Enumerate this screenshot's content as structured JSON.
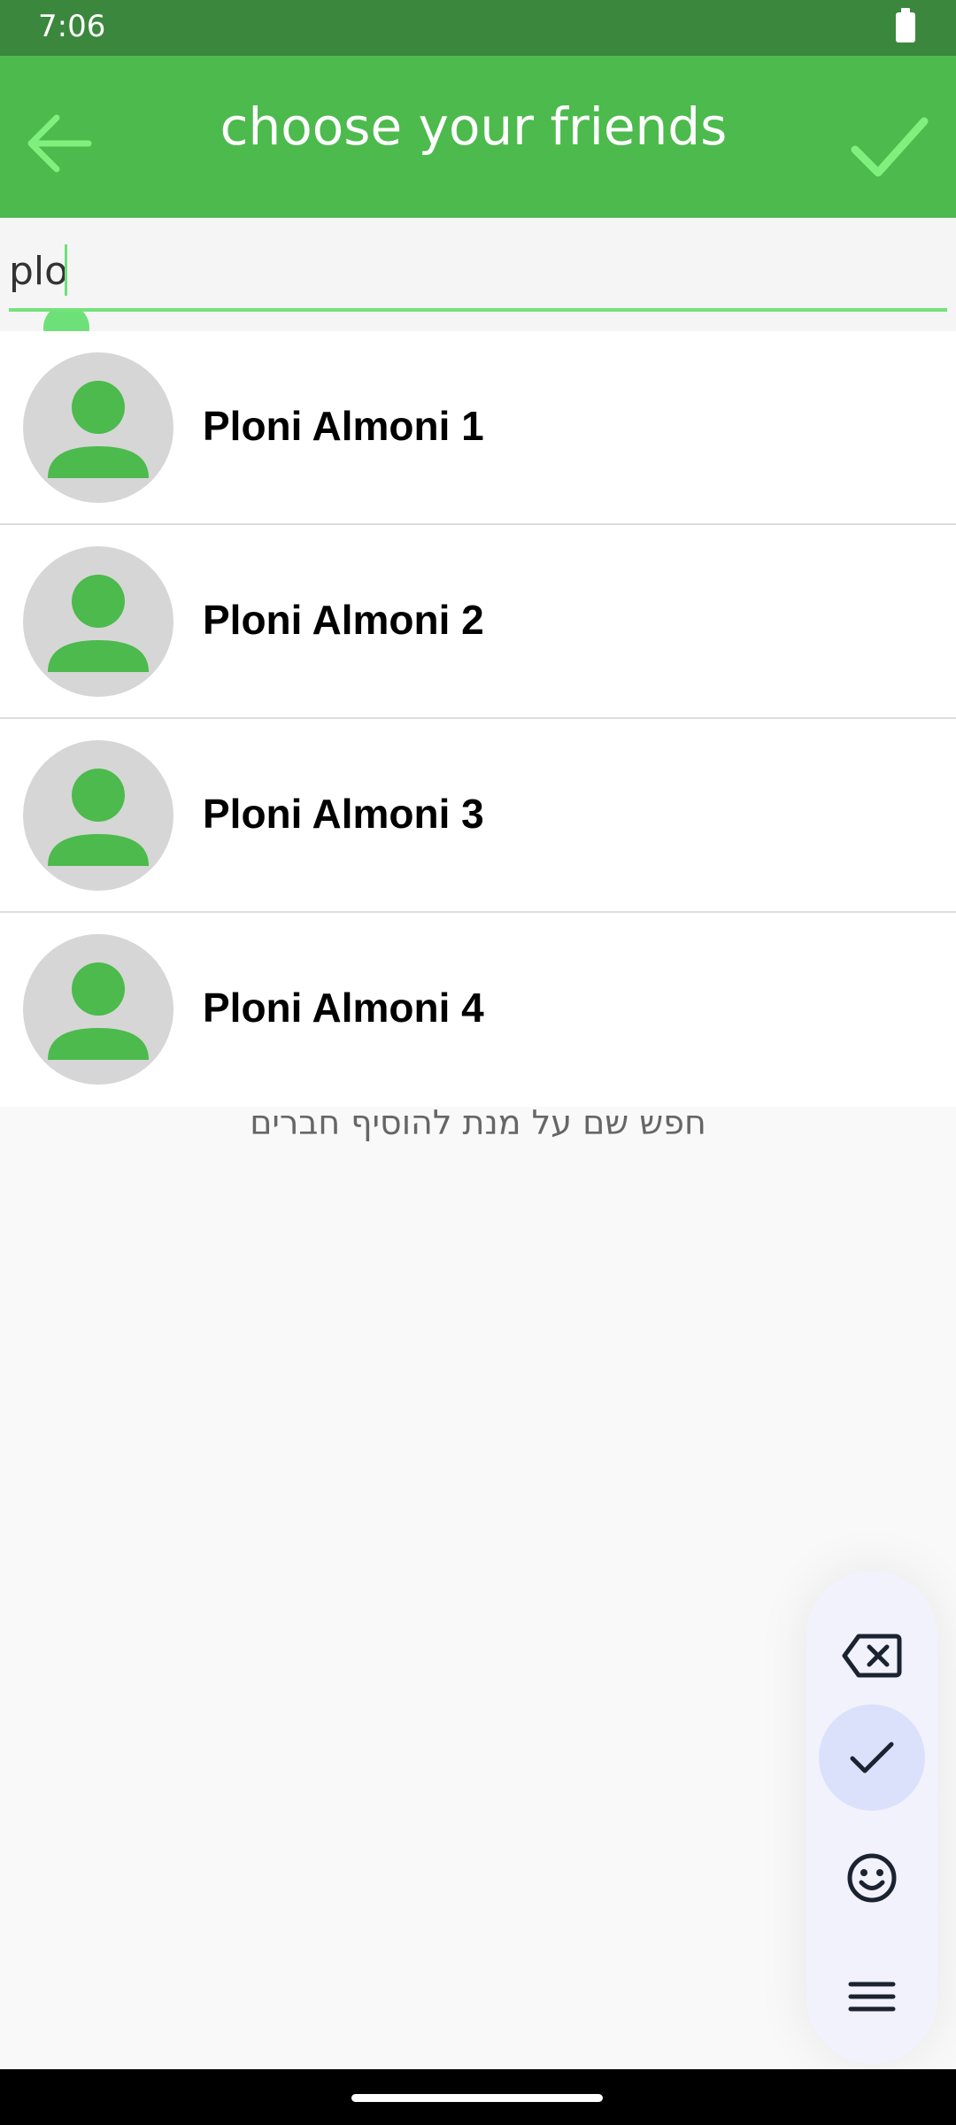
{
  "status_bar": {
    "time": "7:06"
  },
  "app_bar": {
    "title": "choose your friends"
  },
  "search": {
    "value": "plo"
  },
  "friends": [
    {
      "name": "Ploni Almoni 1"
    },
    {
      "name": "Ploni Almoni 2"
    },
    {
      "name": "Ploni Almoni 3"
    },
    {
      "name": "Ploni Almoni 4"
    }
  ],
  "hint": "חפש שם על מנת להוסיף חברים",
  "keyboard_toolbar": {
    "items": [
      "backspace-icon",
      "check-icon",
      "emoji-icon",
      "menu-icon"
    ]
  },
  "colors": {
    "status_bar": "#3b873d",
    "app_bar": "#4cba4c",
    "accent": "#74e27a",
    "avatar_bg": "#d6d6d6",
    "avatar_fg": "#4cba4c"
  }
}
